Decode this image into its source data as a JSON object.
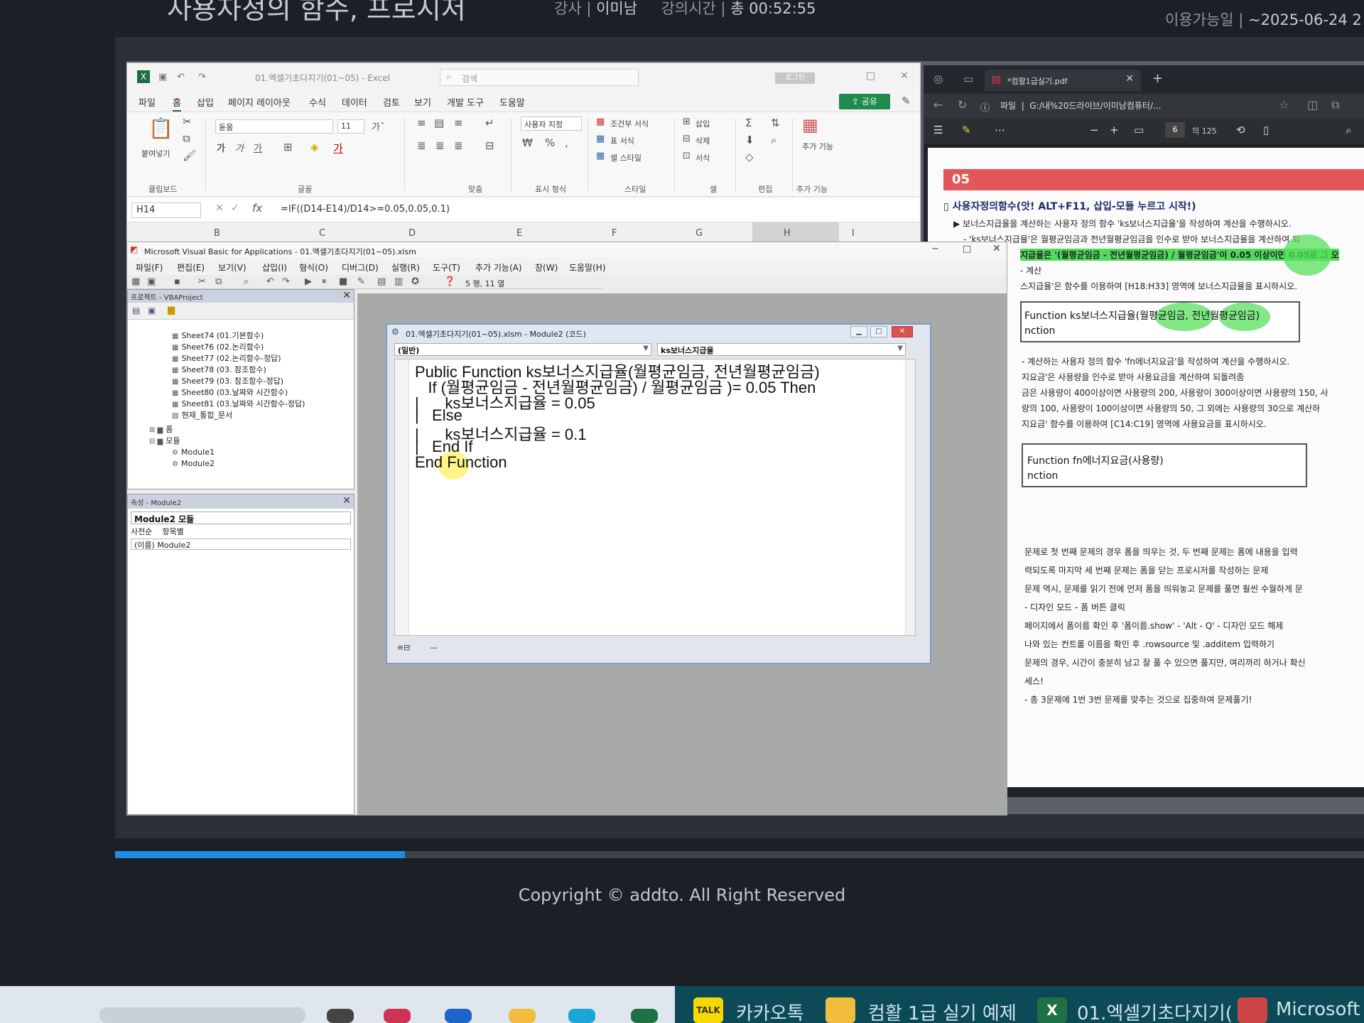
{
  "lecture": {
    "title": "사용자정의 함수, 프로시저",
    "instructor_label": "강사 |",
    "instructor": "이미남",
    "duration_label": "강의시간 |",
    "duration": "총 00:52:55",
    "available_label": "이용가능일 |",
    "available_until": "~2025-06-24 2"
  },
  "excel": {
    "doc_title": "01.엑셀기초다지기(01~05) - Excel",
    "search_placeholder": "검색",
    "login": "로그인",
    "menu": [
      "파일",
      "홈",
      "삽입",
      "페이지 레이아웃",
      "수식",
      "데이터",
      "검토",
      "보기",
      "개발 도구",
      "도움말"
    ],
    "active_menu": "홈",
    "share": "공유",
    "ribbon": {
      "paste": "붙여넣기",
      "font_name": "돋움",
      "font_size": "11",
      "number_format": "사용자 지정",
      "cond_format": "조건부 서식",
      "table_format": "표 서식",
      "cell_style": "셀 스타일",
      "insert": "삽입",
      "delete": "삭제",
      "format": "서식",
      "addins": "추가 기능",
      "group_labels": [
        "클립보드",
        "글꼴",
        "맞춤",
        "표시 형식",
        "스타일",
        "셀",
        "편집",
        "추가 기능"
      ]
    },
    "name_box": "H14",
    "formula": "=IF((D14-E14)/D14>=0.05,0.05,0.1)",
    "columns": [
      "B",
      "C",
      "D",
      "E",
      "F",
      "G",
      "H",
      "I"
    ],
    "selected_column": "H"
  },
  "vba": {
    "title": "Microsoft Visual Basic for Applications - 01.엑셀기초다지기(01~05).xlsm",
    "menu": [
      "파일(F)",
      "편집(E)",
      "보기(V)",
      "삽입(I)",
      "형식(O)",
      "디버그(D)",
      "실행(R)",
      "도구(T)",
      "추가 기능(A)",
      "창(W)",
      "도움말(H)"
    ],
    "cursor_pos": "5 행, 11 열",
    "project": {
      "title": "프로젝트 - VBAProject",
      "nodes": [
        "Sheet74 (01.기본함수)",
        "Sheet76 (02.논리함수)",
        "Sheet77 (02.논리함수-정답)",
        "Sheet78 (03. 참조함수)",
        "Sheet79 (03. 참조함수-정답)",
        "Sheet80 (03.날짜와 시간함수)",
        "Sheet81 (03.날짜와 시간함수-정답)",
        "현재_통합_문서",
        "폼",
        "모듈",
        "Module1",
        "Module2"
      ]
    },
    "properties": {
      "title": "속성 - Module2",
      "object": "Module2 모듈",
      "tab_alpha": "사전순",
      "tab_category": "항목별",
      "row": "(이름) Module2"
    },
    "code_window": {
      "title": "01.엑셀기초다지기(01~05).xlsm - Module2 (코드)",
      "object_combo": "(일반)",
      "proc_combo": "ks보너스지급율",
      "lines": [
        "Public Function ks보너스지급율(월평균임금, 전년월평균임금)",
        "   If (월평균임금 - 전년월평균임금) / 월평균임금 )= 0.05 Then",
        "|      ks보너스지급율 = 0.05",
        "|   Else",
        "|      ks보너스지급율 = 0.1",
        "|   End If",
        "End Function"
      ]
    }
  },
  "pdf": {
    "tab_title": "*컴활1급실기.pdf",
    "url_label": "파일",
    "url": "G:/내%20드라이브/이미남컴퓨터/...",
    "page": "6",
    "page_count": "의 125",
    "section_number": "05",
    "heading": "사용자정의함수(앗! ALT+F11, 삽입-모듈 누르고 시작!)",
    "lines": [
      "▶ 보너스지급율을 계산하는 사용자 정의 함수 'ks보너스지급율'을 작성하여 계산을 수행하시오.",
      "- 'ks보너스지급율'은 월평균임금과 전년월평균임금을 인수로 받아 보너스지급율을 계산하여 되",
      "지급율은 '(월평균임금 - 전년월평균임금) / 월평균임금'이 0.05 이상이면 0.05로 그 오",
      "- 계산",
      "스지급율'은 함수를 이용하여 [H18:H33] 영역에 보너스지급율을 표시하시오.",
      "Function ks보너스지급율(월평균임금, 전년월평균임금)",
      "nction",
      "- 계산하는 사용자 정의 함수 'fn에너지요금'을 작성하여 계산을 수행하시오.",
      "지요금'은 사용량을 인수로 받아 사용요금을 계산하여 되돌려줌",
      "금은 사용량이 400이상이면 사용량의 200, 사용량이 300이상이면 사용량의 150, 사",
      "량의 100, 사용량이 100이상이면 사용량의 50, 그 외에는 사용량의 30으로 계산하",
      "지요금' 함수를 이용하여 [C14:C19] 영역에 사용요금을 표시하시오.",
      "Function fn에너지요금(사용량)",
      "nction",
      "문제로 첫 번째 문제의 경우 폼을 띄우는 것, 두 번째 문제는 폼에 내용을 입력",
      "력되도록 마지막 세 번째 문제는 폼을 닫는 프로시저를 작성하는 문제",
      "문제 역시, 문제를 읽기 전에 먼저 폼을 띄워놓고 문제를 풀면 훨씬 수월하게 문",
      "- 디자인 모드 - 폼 버튼 클릭",
      "페이지에서 폼이름 확인 후 '폼이름.show' - 'Alt - Q' - 디자인 모드 해제",
      "나와 있는 컨트롤 이름을 확인 후 .rowsource 및 .additem 입력하기",
      "문제의 경우, 시간이 충분히 남고 잘 풀 수 있으면 풀지만, 여리까리 하거나 확신",
      "세스!",
      "- 총 3문제에 1번 3번 문제를 맞추는 것으로 집중하여 문제풀기!"
    ]
  },
  "video": {
    "progress": 0.232
  },
  "footer": {
    "copyright": "Copyright © addto. All Right Reserved"
  },
  "taskbar": {
    "kakao_icon": "TALK",
    "kakao": "카카오톡",
    "folder": "컴활 1급 실기 예제",
    "excel_icon": "X",
    "excel": "01.엑셀기초다지기(",
    "vba": "Microsoft Vi"
  }
}
